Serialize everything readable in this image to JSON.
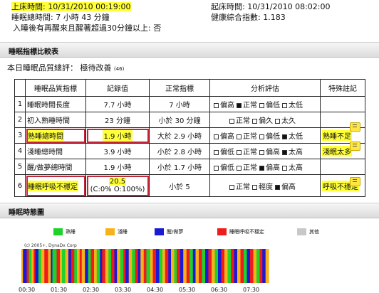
{
  "header": {
    "bedtime": "上床時間: 10/31/2010 00:19:00",
    "wake_time": "起床時間: 10/31/2010 08:02:00",
    "sleep_duration": "睡眠總時間: 7 小時 43 分鐘",
    "health_index": "健康綜合指數: 1.183",
    "awake_over30": "入睡後有再醒來且醒著超過30分鐘以上: 否"
  },
  "section1": {
    "title": "睡眠指標比較表",
    "summary_label": "本日睡眠品質總評：",
    "summary_value": "極待改善",
    "summary_score": "(46)"
  },
  "table": {
    "headers": [
      "睡眠品質指標",
      "記錄值",
      "正常指標",
      "分析評估",
      "特殊註記"
    ],
    "rows": [
      {
        "num": "1",
        "name": "睡眠時間長度",
        "value": "7.7 小時",
        "value2": "",
        "normal": "7 小時",
        "options": [
          {
            "label": "偏高",
            "checked": false
          },
          {
            "label": "正常",
            "checked": true
          },
          {
            "label": "偏低",
            "checked": false
          },
          {
            "label": "太低",
            "checked": false
          }
        ],
        "note": ""
      },
      {
        "num": "2",
        "name": "初入熟睡時間",
        "value": "23 分鐘",
        "value2": "",
        "normal": "小於 30 分鐘",
        "options": [
          {
            "label": "正常",
            "checked": false
          },
          {
            "label": "偏久",
            "checked": false
          },
          {
            "label": "太久",
            "checked": false
          }
        ],
        "note": ""
      },
      {
        "num": "3",
        "name": "熟睡總時間",
        "value": "1.9 小時",
        "value2": "",
        "normal": "大於 2.9 小時",
        "options": [
          {
            "label": "偏高",
            "checked": false
          },
          {
            "label": "正常",
            "checked": false
          },
          {
            "label": "偏低",
            "checked": false
          },
          {
            "label": "太低",
            "checked": true
          }
        ],
        "note": "熟睡不足"
      },
      {
        "num": "4",
        "name": "淺睡總時間",
        "value": "3.9 小時",
        "value2": "",
        "normal": "小於 2.8 小時",
        "options": [
          {
            "label": "偏低",
            "checked": false
          },
          {
            "label": "正常",
            "checked": false
          },
          {
            "label": "偏高",
            "checked": false
          },
          {
            "label": "太高",
            "checked": true
          }
        ],
        "note": "淺眠太多"
      },
      {
        "num": "5",
        "name": "醒/做夢總時間",
        "value": "1.9 小時",
        "value2": "",
        "normal": "小於 1.7 小時",
        "options": [
          {
            "label": "偏低",
            "checked": false
          },
          {
            "label": "正常",
            "checked": false
          },
          {
            "label": "偏高",
            "checked": true
          },
          {
            "label": "太高",
            "checked": false
          }
        ],
        "note": ""
      },
      {
        "num": "6",
        "name": "睡眠呼吸不穩定",
        "value": "20.5",
        "value2": "(C:0% O:100%)",
        "normal": "小於 5",
        "options": [
          {
            "label": "正常",
            "checked": false
          },
          {
            "label": "輕度",
            "checked": false
          },
          {
            "label": "偏高",
            "checked": true
          }
        ],
        "note": "呼吸不穩定"
      }
    ]
  },
  "section2": {
    "title": "睡眠時態圖",
    "copyright": "(c) 2005+, DynaDx Corp",
    "legend": [
      {
        "label": "熟睡",
        "color": "#1fd12a"
      },
      {
        "label": "淺睡",
        "color": "#f7b21b"
      },
      {
        "label": "醒/做夢",
        "color": "#1a1ad6"
      },
      {
        "label": "睡眠呼吸不穩定",
        "color": "#ee1c1c"
      },
      {
        "label": "其他",
        "color": "#c8c8c8"
      }
    ],
    "x_ticks": [
      "00:30",
      "01:30",
      "02:30",
      "03:30",
      "04:30",
      "05:30",
      "06:30",
      "07:30"
    ]
  },
  "chart_data": {
    "type": "bar",
    "title": "",
    "x_domain": [
      "00:19",
      "08:02"
    ],
    "segments": [
      [
        "00:19",
        "00:22",
        "淺睡"
      ],
      [
        "00:22",
        "00:29",
        "醒/做夢"
      ],
      [
        "00:29",
        "00:33",
        "睡眠呼吸不穩定"
      ],
      [
        "00:33",
        "00:38",
        "熟睡"
      ],
      [
        "00:38",
        "00:42",
        "淺睡"
      ],
      [
        "00:42",
        "00:45",
        "睡眠呼吸不穩定"
      ],
      [
        "00:45",
        "00:51",
        "醒/做夢"
      ],
      [
        "00:51",
        "00:56",
        "熟睡"
      ],
      [
        "00:56",
        "01:02",
        "淺睡"
      ],
      [
        "01:02",
        "01:09",
        "睡眠呼吸不穩定"
      ],
      [
        "01:09",
        "01:14",
        "淺睡"
      ],
      [
        "01:14",
        "01:17",
        "醒/做夢"
      ],
      [
        "01:17",
        "01:25",
        "熟睡"
      ],
      [
        "01:25",
        "01:31",
        "睡眠呼吸不穩定"
      ],
      [
        "01:31",
        "01:35",
        "淺睡"
      ],
      [
        "01:35",
        "01:41",
        "熟睡"
      ],
      [
        "01:41",
        "01:47",
        "淺睡"
      ],
      [
        "01:47",
        "01:52",
        "醒/做夢"
      ],
      [
        "01:52",
        "01:58",
        "睡眠呼吸不穩定"
      ],
      [
        "01:58",
        "02:03",
        "熟睡"
      ],
      [
        "02:03",
        "02:08",
        "淺睡"
      ],
      [
        "02:08",
        "02:12",
        "睡眠呼吸不穩定"
      ],
      [
        "02:12",
        "02:18",
        "淺睡"
      ],
      [
        "02:18",
        "02:24",
        "醒/做夢"
      ],
      [
        "02:24",
        "02:29",
        "熟睡"
      ],
      [
        "02:29",
        "02:35",
        "睡眠呼吸不穩定"
      ],
      [
        "02:35",
        "02:40",
        "淺睡"
      ],
      [
        "02:40",
        "02:46",
        "熟睡"
      ],
      [
        "02:46",
        "02:50",
        "醒/做夢"
      ],
      [
        "02:50",
        "02:56",
        "睡眠呼吸不穩定"
      ],
      [
        "02:56",
        "03:02",
        "淺睡"
      ],
      [
        "03:02",
        "03:07",
        "熟睡"
      ],
      [
        "03:07",
        "03:13",
        "睡眠呼吸不穩定"
      ],
      [
        "03:13",
        "03:18",
        "醒/做夢"
      ],
      [
        "03:18",
        "03:24",
        "淺睡"
      ],
      [
        "03:24",
        "03:30",
        "熟睡"
      ],
      [
        "03:30",
        "03:34",
        "睡眠呼吸不穩定"
      ],
      [
        "03:34",
        "03:40",
        "醒/做夢"
      ],
      [
        "03:40",
        "03:46",
        "淺睡"
      ],
      [
        "03:46",
        "03:52",
        "熟睡"
      ],
      [
        "03:52",
        "03:57",
        "睡眠呼吸不穩定"
      ],
      [
        "03:57",
        "04:02",
        "醒/做夢"
      ],
      [
        "04:02",
        "04:08",
        "淺睡"
      ],
      [
        "04:08",
        "04:13",
        "睡眠呼吸不穩定"
      ],
      [
        "04:13",
        "04:20",
        "熟睡"
      ],
      [
        "04:20",
        "04:25",
        "淺睡"
      ],
      [
        "04:25",
        "04:31",
        "睡眠呼吸不穩定"
      ],
      [
        "04:31",
        "04:37",
        "醒/做夢"
      ],
      [
        "04:37",
        "04:43",
        "熟睡"
      ],
      [
        "04:43",
        "04:48",
        "淺睡"
      ],
      [
        "04:48",
        "04:54",
        "睡眠呼吸不穩定"
      ],
      [
        "04:54",
        "04:59",
        "醒/做夢"
      ],
      [
        "04:59",
        "05:05",
        "淺睡"
      ],
      [
        "05:05",
        "05:10",
        "熟睡"
      ],
      [
        "05:10",
        "05:16",
        "睡眠呼吸不穩定"
      ],
      [
        "05:16",
        "05:22",
        "醒/做夢"
      ],
      [
        "05:22",
        "05:28",
        "淺睡"
      ],
      [
        "05:28",
        "05:34",
        "睡眠呼吸不穩定"
      ],
      [
        "05:34",
        "05:40",
        "熟睡"
      ],
      [
        "05:40",
        "05:45",
        "醒/做夢"
      ],
      [
        "05:45",
        "05:51",
        "淺睡"
      ],
      [
        "05:51",
        "05:57",
        "睡眠呼吸不穩定"
      ],
      [
        "05:57",
        "06:03",
        "熟睡"
      ],
      [
        "06:03",
        "06:09",
        "醒/做夢"
      ],
      [
        "06:09",
        "06:15",
        "睡眠呼吸不穩定"
      ],
      [
        "06:15",
        "06:21",
        "淺睡"
      ],
      [
        "06:21",
        "06:27",
        "熟睡"
      ],
      [
        "06:27",
        "06:33",
        "醒/做夢"
      ],
      [
        "06:33",
        "06:39",
        "睡眠呼吸不穩定"
      ],
      [
        "06:39",
        "06:45",
        "淺睡"
      ],
      [
        "06:45",
        "06:51",
        "熟睡"
      ],
      [
        "06:51",
        "06:57",
        "睡眠呼吸不穩定"
      ],
      [
        "06:57",
        "07:03",
        "醒/做夢"
      ],
      [
        "07:03",
        "07:09",
        "淺睡"
      ],
      [
        "07:09",
        "07:15",
        "睡眠呼吸不穩定"
      ],
      [
        "07:15",
        "07:21",
        "熟睡"
      ],
      [
        "07:21",
        "07:27",
        "醒/做夢"
      ],
      [
        "07:27",
        "07:33",
        "睡眠呼吸不穩定"
      ],
      [
        "07:33",
        "07:39",
        "淺睡"
      ],
      [
        "07:39",
        "07:45",
        "熟睡"
      ],
      [
        "07:45",
        "07:50",
        "睡眠呼吸不穩定"
      ],
      [
        "07:50",
        "07:56",
        "醒/做夢"
      ],
      [
        "07:56",
        "08:02",
        "淺睡"
      ]
    ]
  }
}
